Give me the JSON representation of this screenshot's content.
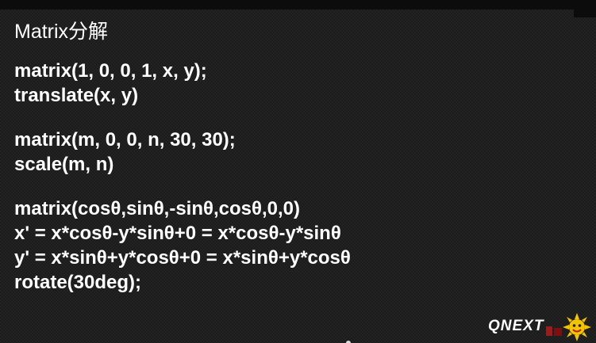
{
  "slide": {
    "title": "Matrix分解",
    "groups": [
      {
        "lines": [
          "matrix(1, 0, 0, 1, x, y);",
          "translate(x, y)"
        ]
      },
      {
        "lines": [
          "matrix(m, 0, 0, n, 30, 30);",
          "scale(m, n)"
        ]
      },
      {
        "lines": [
          "matrix(cosθ,sinθ,-sinθ,cosθ,0,0)",
          "x' = x*cosθ-y*sinθ+0 = x*cosθ-y*sinθ",
          "y' = x*sinθ+y*cosθ+0 = x*sinθ+y*cosθ",
          "rotate(30deg);"
        ]
      }
    ]
  },
  "watermark": {
    "brand": "QNEXT",
    "mascot_icon": "sun-mascot-icon",
    "accent_color": "#f5c400"
  }
}
